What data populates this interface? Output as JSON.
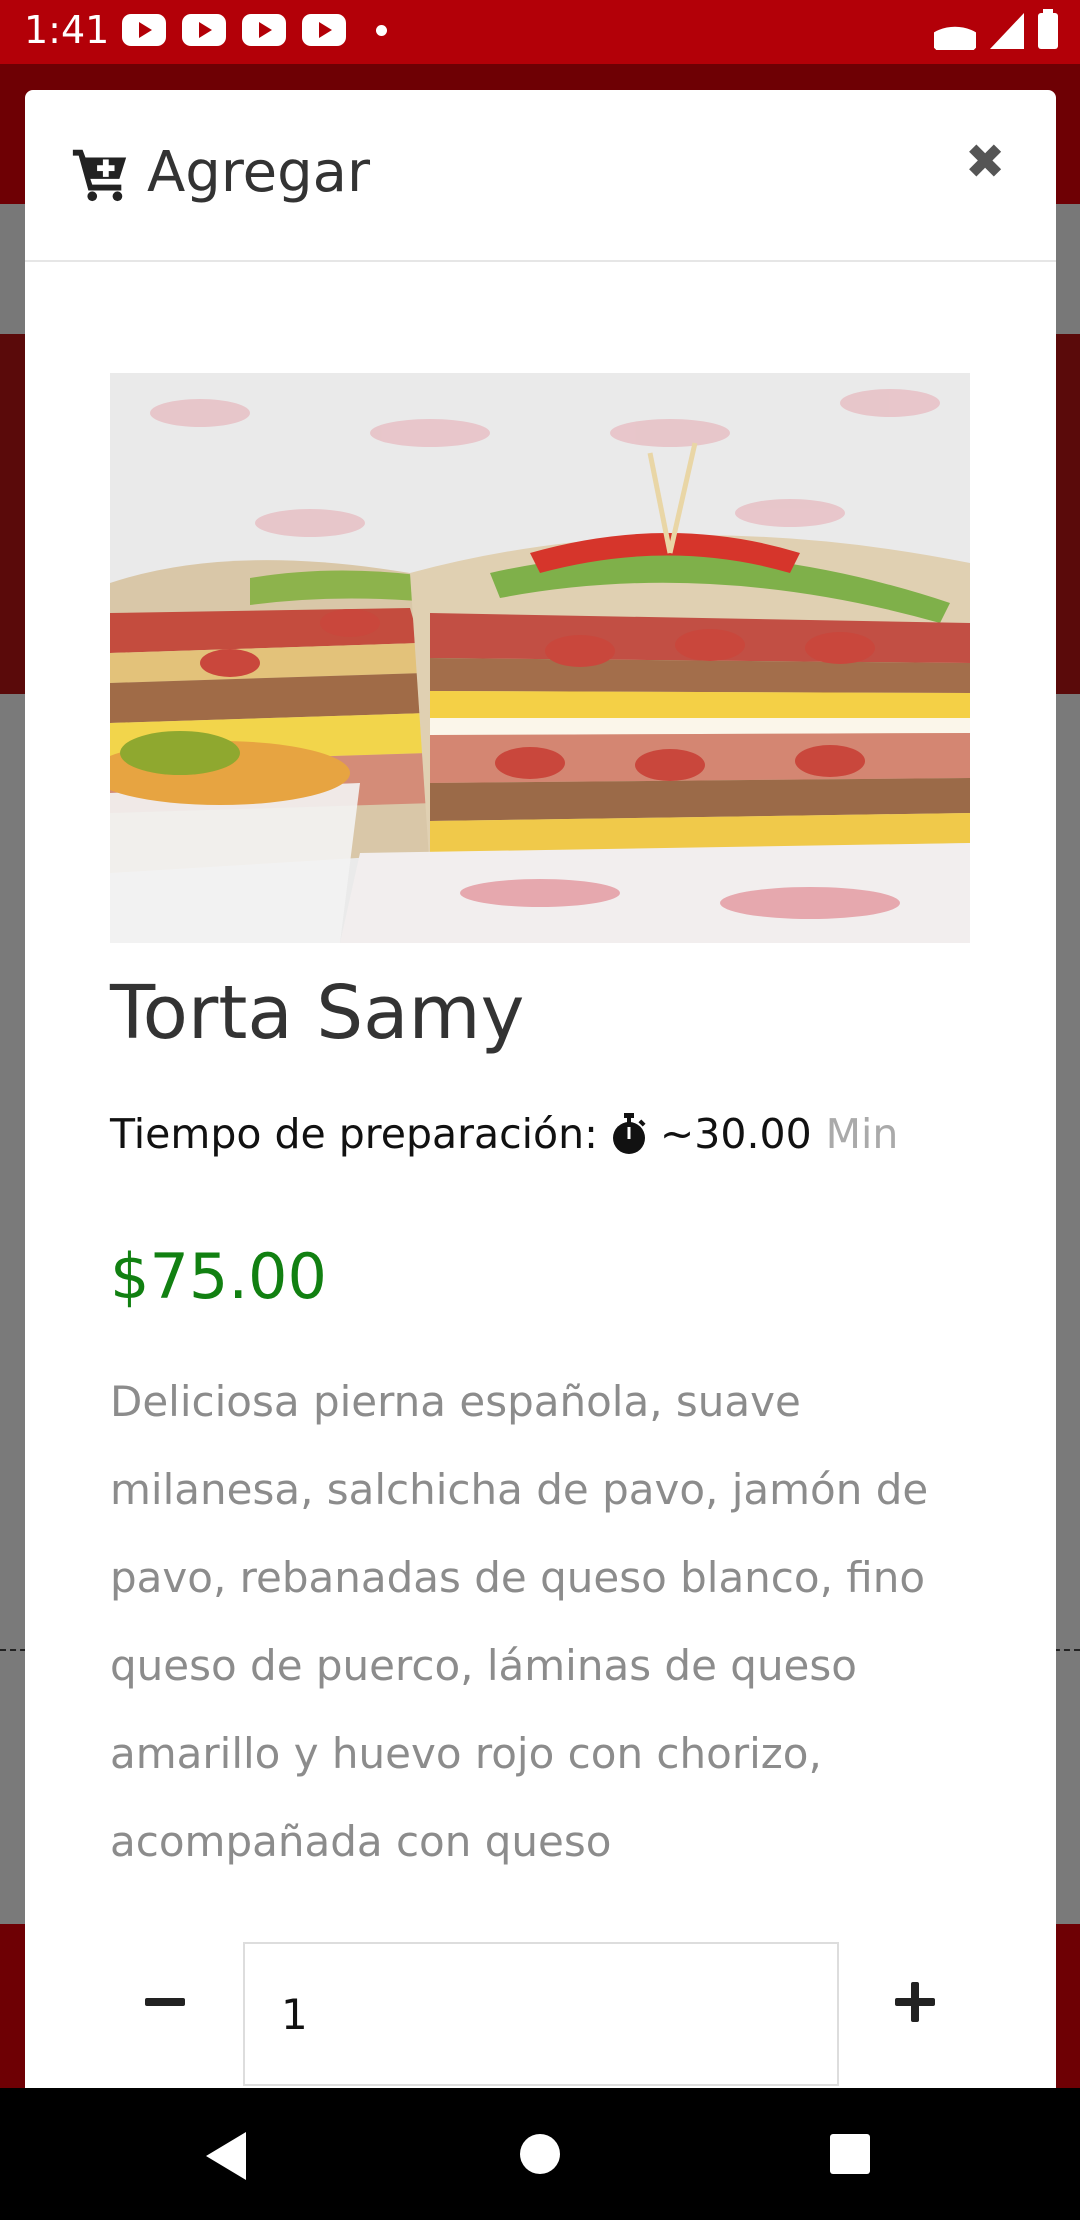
{
  "status_bar": {
    "time": "1:41",
    "notification_icons": [
      "youtube-icon",
      "youtube-icon",
      "youtube-icon",
      "youtube-icon",
      "dot-icon"
    ],
    "system_icons": [
      "wifi-icon",
      "signal-icon",
      "battery-icon"
    ]
  },
  "modal": {
    "title": "Agregar",
    "title_icon": "cart-plus-icon",
    "close_icon": "close-icon"
  },
  "product": {
    "name": "Torta Samy",
    "prep_label": "Tiempo de preparación:",
    "prep_value": "~30.00",
    "prep_unit": "Min",
    "price": "$75.00",
    "description": "Deliciosa pierna española, suave milanesa, salchicha de pavo, jamón de pavo, rebanadas de queso blanco, fino queso de puerco, láminas de queso amarillo y huevo rojo con chorizo, acompañada con queso"
  },
  "quantity": {
    "value": "1"
  },
  "colors": {
    "status_bar": "#b30008",
    "price": "#118011",
    "description": "#8c8c8c",
    "prep_unit": "#aaaaaa"
  }
}
